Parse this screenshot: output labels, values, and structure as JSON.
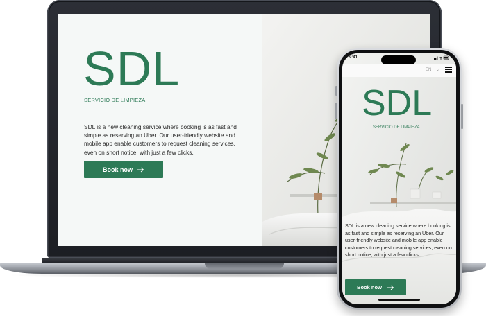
{
  "laptop": {
    "brand": "SDL",
    "tagline": "SERVICIO DE LIMPIEZA",
    "description": "SDL is a new cleaning service where booking is as fast and simple as reserving an Uber. Our user-friendly website and mobile app enable customers to request cleaning services, even on short notice, with just a few clicks.",
    "cta_label": "Book now",
    "cta_icon": "arrow-right-icon"
  },
  "phone": {
    "status_time": "9:41",
    "status_icons": "signal-wifi-battery",
    "language": "EN",
    "menu_icon": "hamburger-menu-icon",
    "brand": "SDL",
    "tagline": "SERVICIO DE LIMPIEZA",
    "description": "SDL is a new cleaning service where booking is as fast and simple as reserving an Uber. Our user-friendly website and mobile app enable customers to request cleaning services, even on short notice, with just a few clicks.",
    "cta_label": "Book now",
    "cta_icon": "arrow-right-icon"
  },
  "colors": {
    "brand_green": "#2d7a56",
    "screen_bg": "#f5f8f7",
    "device_dark": "#1c1e23"
  }
}
